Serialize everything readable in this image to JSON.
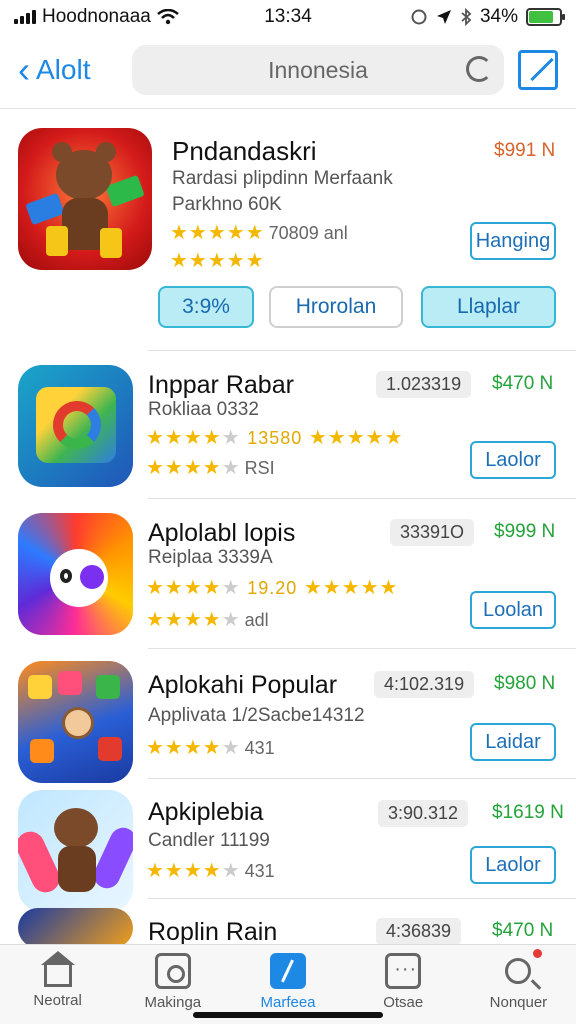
{
  "status_bar": {
    "carrier": "Hoodnonaaa",
    "time": "13:34",
    "battery": "34%",
    "icons": [
      "signal-icon",
      "wifi-icon",
      "location-icon",
      "bluetooth-icon",
      "battery-icon"
    ]
  },
  "nav": {
    "back_label": "Alolt",
    "search_text": "Innonesia",
    "icons": [
      "chevron-left-icon",
      "refresh-icon",
      "compose-icon"
    ]
  },
  "featured": {
    "title": "Pndandaskri",
    "subtitle": "Rardasi plipdinn Merfaank",
    "subtitle2": "Parkhno 60K",
    "stars": "★★★★★",
    "rating_text": "70809 anl",
    "stars2": "★★★★★",
    "price": "$991 N",
    "action_label": "Hanging",
    "pills": [
      "3:9%",
      "Hrorolan",
      "Llaplar"
    ]
  },
  "apps": [
    {
      "title": "Inppar Rabar",
      "subtitle": "Rokliaa 0332",
      "rank": "1.023319",
      "price": "$470 N",
      "rating_stars": "★★★★",
      "rating_dim": "★",
      "rating_text": "13580",
      "rating2_stars": "★★★★",
      "rating2_text": "★",
      "stars3": "★★★★",
      "stars3_dim": "★",
      "meta": "RSI",
      "button": "Laolor"
    },
    {
      "title": "Aplolabl lopis",
      "subtitle": "Reiplaa 3339A",
      "rank": "33391O",
      "price": "$999 N",
      "rating_stars": "★★★★",
      "rating_dim": "★",
      "rating_text": "19.20",
      "rating2_stars": "★★★★",
      "rating2_text": "★",
      "stars3": "★★★★",
      "stars3_dim": "★",
      "meta": "adl",
      "button": "Loolan"
    },
    {
      "title": "Aplokahi Popular",
      "subtitle": "Applivata 1/2Sacbe14312",
      "rank": "4:102.319",
      "price": "$980 N",
      "stars3": "★★★★",
      "stars3_dim": "★",
      "meta": "431",
      "button": "Laidar"
    },
    {
      "title": "Apkiplebia",
      "subtitle": "Candler 11199",
      "rank": "3:90.312",
      "price": "$1619 N",
      "stars3": "★★★★",
      "stars3_dim": "★",
      "meta": "431",
      "button": "Laolor"
    },
    {
      "title": "Roplin Rain",
      "rank": "4:36839",
      "price": "$470 N"
    }
  ],
  "tabs": [
    {
      "label": "Neotral",
      "icon": "home-icon"
    },
    {
      "label": "Makinga",
      "icon": "camera-icon"
    },
    {
      "label": "Marfeea",
      "icon": "activity-icon",
      "active": true
    },
    {
      "label": "Otsae",
      "icon": "chat-icon"
    },
    {
      "label": "Nonquer",
      "icon": "search-icon"
    }
  ],
  "colors": {
    "accent": "#1e88e5",
    "price_orange": "#d6632b",
    "price_green": "#23a33a",
    "star": "#f5b800",
    "pill_fill": "#b9ecf4"
  }
}
